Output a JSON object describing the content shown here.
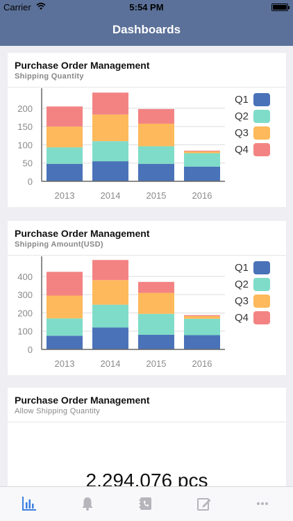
{
  "status_bar": {
    "carrier": "Carrier",
    "time": "5:54 PM"
  },
  "nav": {
    "title": "Dashboards"
  },
  "cards": [
    {
      "title": "Purchase Order Management",
      "subtitle": "Shipping Quantity"
    },
    {
      "title": "Purchase Order Management",
      "subtitle": "Shipping Amount(USD)"
    },
    {
      "title": "Purchase Order Management",
      "subtitle": "Allow Shipping Quantity",
      "value": "2,294,076 pcs"
    }
  ],
  "colors": {
    "q1": "#4a72b8",
    "q2": "#7fdcc8",
    "q3": "#fdb95b",
    "q4": "#f38383",
    "nav": "#5b7199",
    "tab_active": "#3a7fe0",
    "tab_inactive": "#b5b5bb"
  },
  "chart_data": [
    {
      "type": "bar",
      "stacked": true,
      "categories": [
        "2013",
        "2014",
        "2015",
        "2016"
      ],
      "series": [
        {
          "name": "Q1",
          "values": [
            48,
            55,
            48,
            40
          ]
        },
        {
          "name": "Q2",
          "values": [
            45,
            55,
            48,
            37
          ]
        },
        {
          "name": "Q3",
          "values": [
            57,
            73,
            62,
            5
          ]
        },
        {
          "name": "Q4",
          "values": [
            55,
            60,
            40,
            2
          ]
        }
      ],
      "yticks": [
        0,
        50,
        100,
        150,
        200
      ],
      "ylim": [
        0,
        255
      ],
      "legend": "right"
    },
    {
      "type": "bar",
      "stacked": true,
      "categories": [
        "2013",
        "2014",
        "2015",
        "2016"
      ],
      "series": [
        {
          "name": "Q1",
          "values": [
            75,
            120,
            80,
            78
          ]
        },
        {
          "name": "Q2",
          "values": [
            95,
            125,
            115,
            90
          ]
        },
        {
          "name": "Q3",
          "values": [
            125,
            135,
            115,
            15
          ]
        },
        {
          "name": "Q4",
          "values": [
            130,
            110,
            60,
            5
          ]
        }
      ],
      "yticks": [
        0,
        100,
        200,
        300,
        400
      ],
      "ylim": [
        0,
        510
      ],
      "legend": "right"
    }
  ],
  "tabs": [
    {
      "icon": "bar-chart-icon",
      "active": true
    },
    {
      "icon": "bell-icon",
      "active": false
    },
    {
      "icon": "phone-book-icon",
      "active": false
    },
    {
      "icon": "edit-icon",
      "active": false
    },
    {
      "icon": "more-icon",
      "active": false
    }
  ]
}
